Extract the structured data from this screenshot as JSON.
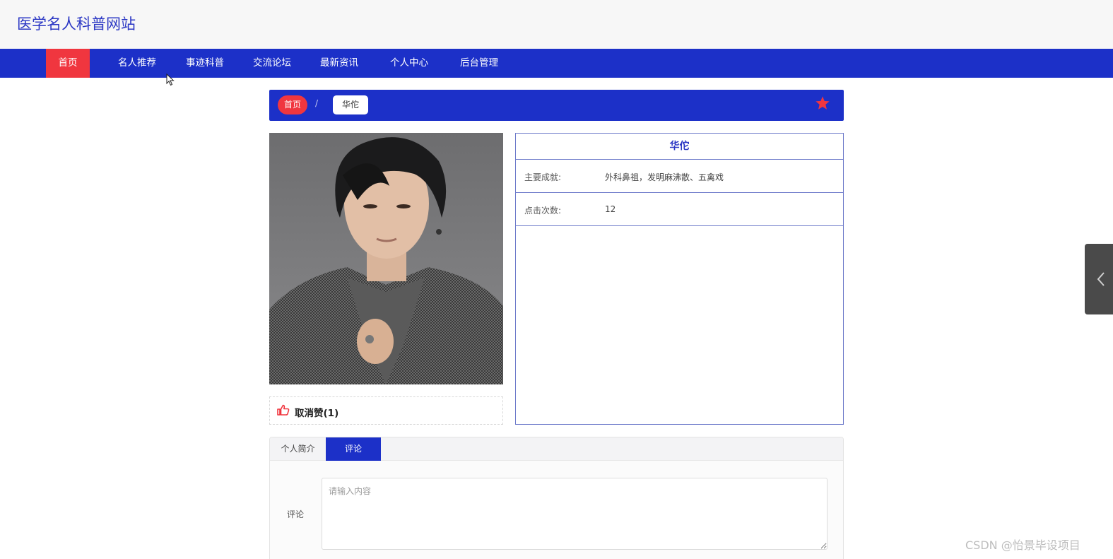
{
  "site": {
    "title": "医学名人科普网站"
  },
  "nav": {
    "items": [
      {
        "label": "首页",
        "active": true
      },
      {
        "label": "名人推荐",
        "active": false
      },
      {
        "label": "事迹科普",
        "active": false
      },
      {
        "label": "交流论坛",
        "active": false
      },
      {
        "label": "最新资讯",
        "active": false
      },
      {
        "label": "个人中心",
        "active": false
      },
      {
        "label": "后台管理",
        "active": false
      }
    ]
  },
  "breadcrumb": {
    "home": "首页",
    "separator": "/",
    "current": "华佗"
  },
  "person": {
    "name": "华佗",
    "achievements_label": "主要成就:",
    "achievements": "外科鼻祖，发明麻沸散、五禽戏",
    "clicks_label": "点击次数:",
    "clicks": "12"
  },
  "like": {
    "label": "取消赞(1)"
  },
  "tabs": [
    {
      "label": "个人简介",
      "active": false
    },
    {
      "label": "评论",
      "active": true
    }
  ],
  "comment": {
    "label": "评论",
    "placeholder": "请输入内容",
    "value": ""
  },
  "watermark": "CSDN @怡景毕设项目",
  "colors": {
    "primary": "#1c30c8",
    "accent": "#f0363f",
    "title": "#2b37c4"
  }
}
